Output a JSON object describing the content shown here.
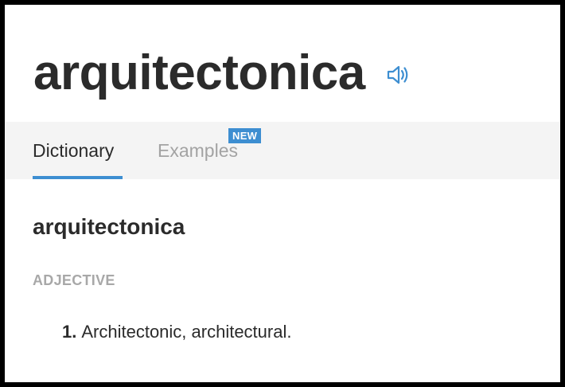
{
  "headword": {
    "text": "arquitectonica",
    "audio_icon": "speaker-icon"
  },
  "tabs": [
    {
      "label": "Dictionary",
      "active": true
    },
    {
      "label": "Examples",
      "active": false,
      "badge": "NEW"
    }
  ],
  "entry": {
    "title": "arquitectonica",
    "part_of_speech": "ADJECTIVE",
    "senses": [
      {
        "number": "1.",
        "text": "Architectonic, architectural."
      }
    ]
  },
  "colors": {
    "accent": "#3d8ed1",
    "text": "#2b2b2b",
    "muted": "#a3a3a3",
    "tab_background": "#f4f4f4"
  }
}
